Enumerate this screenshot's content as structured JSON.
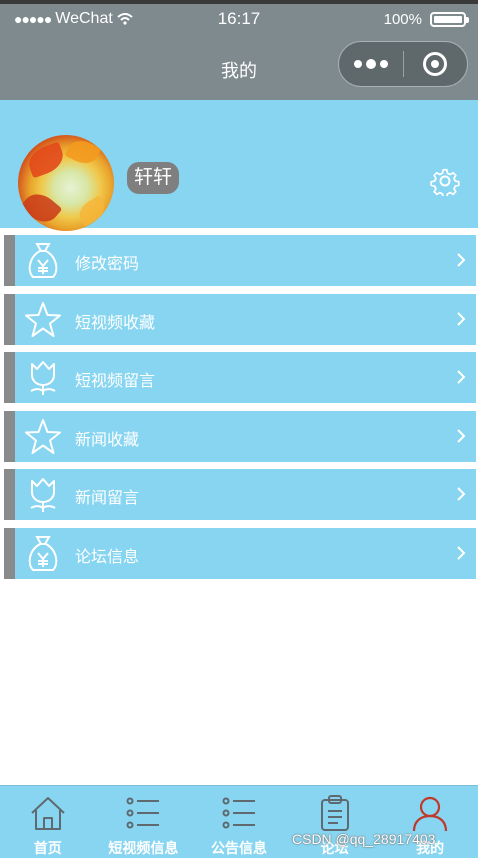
{
  "status_bar": {
    "carrier": "WeChat",
    "time": "16:17",
    "battery": "100%"
  },
  "nav": {
    "title": "我的"
  },
  "profile": {
    "username": "轩轩"
  },
  "menu": {
    "items": [
      {
        "label": "修改密码",
        "icon": "money-bag-icon"
      },
      {
        "label": "短视频收藏",
        "icon": "star-icon"
      },
      {
        "label": "短视频留言",
        "icon": "tulip-icon"
      },
      {
        "label": "新闻收藏",
        "icon": "star-icon"
      },
      {
        "label": "新闻留言",
        "icon": "tulip-icon"
      },
      {
        "label": "论坛信息",
        "icon": "money-bag-icon"
      }
    ]
  },
  "tabbar": {
    "items": [
      {
        "label": "首页",
        "icon": "home-icon"
      },
      {
        "label": "短视频信息",
        "icon": "list-icon"
      },
      {
        "label": "公告信息",
        "icon": "list-icon"
      },
      {
        "label": "论坛",
        "icon": "clipboard-icon"
      },
      {
        "label": "我的",
        "icon": "user-icon",
        "active": true
      }
    ]
  },
  "watermark": "CSDN @qq_28917403",
  "colors": {
    "header": "#7f8a8e",
    "accent": "#87d5f1",
    "menu_bar": "#888a8b",
    "tab_active_icon": "#c0392b"
  }
}
